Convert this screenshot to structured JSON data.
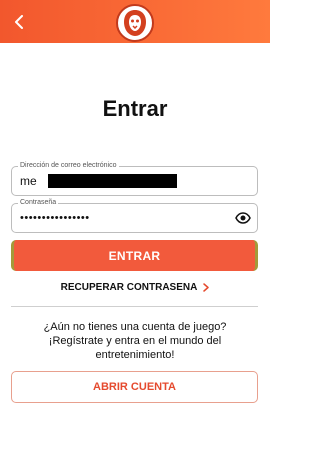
{
  "header": {
    "back_icon": "chevron-left-icon",
    "logo_icon": "lion-logo-icon"
  },
  "page": {
    "title": "Entrar"
  },
  "form": {
    "email_label": "Dirección de correo electrónico",
    "email_value": "me",
    "password_label": "Contraseña",
    "password_value": "••••••••••••••••",
    "show_password_icon": "eye-icon"
  },
  "actions": {
    "login_label": "ENTRAR",
    "recover_label": "RECUPERAR CONTRASENA",
    "recover_icon": "chevron-right-icon",
    "no_account_line1": "¿Aún no tienes una cuenta de juego?",
    "no_account_line2": "¡Regístrate y entra en el mundo del",
    "no_account_line3": "entretenimiento!",
    "open_account_label": "ABRIR CUENTA"
  },
  "colors": {
    "header_start": "#f2572d",
    "header_end": "#ff7a3d",
    "primary": "#f25a3c",
    "secondary_text": "#e54a2e"
  }
}
